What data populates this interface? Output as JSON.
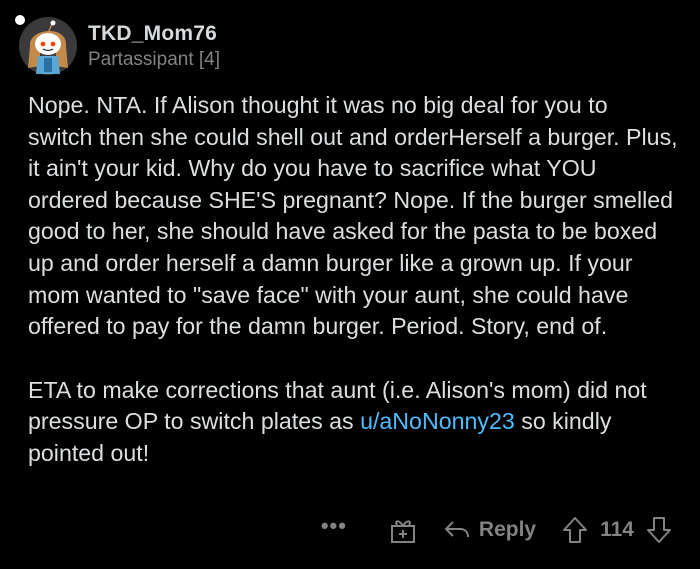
{
  "comment": {
    "author": "TKD_Mom76",
    "flair": "Partassipant [4]",
    "paragraphs": [
      "Nope. NTA. If Alison thought it was no big deal for you to switch then she could shell out and orderHerself a burger. Plus, it ain't your kid. Why do you have to sacrifice what YOU ordered because SHE'S pregnant? Nope. If the burger smelled good to her, she should have asked for the pasta to be boxed up and order herself a damn burger like a grown up. If your mom wanted to \"save face\" with your aunt, she could have offered to pay for the damn burger. Period. Story, end of."
    ],
    "edit_prefix": "ETA to make corrections that aunt (i.e. Alison's mom) did not pressure OP to switch plates as ",
    "edit_link": "u/aNoNonny23",
    "edit_suffix": " so kindly pointed out!"
  },
  "actions": {
    "more_label": "•••",
    "reply_label": "Reply",
    "score": "114"
  },
  "colors": {
    "background": "#000000",
    "text": "#dcdfe1",
    "muted": "#818384",
    "link": "#4fbcff"
  }
}
